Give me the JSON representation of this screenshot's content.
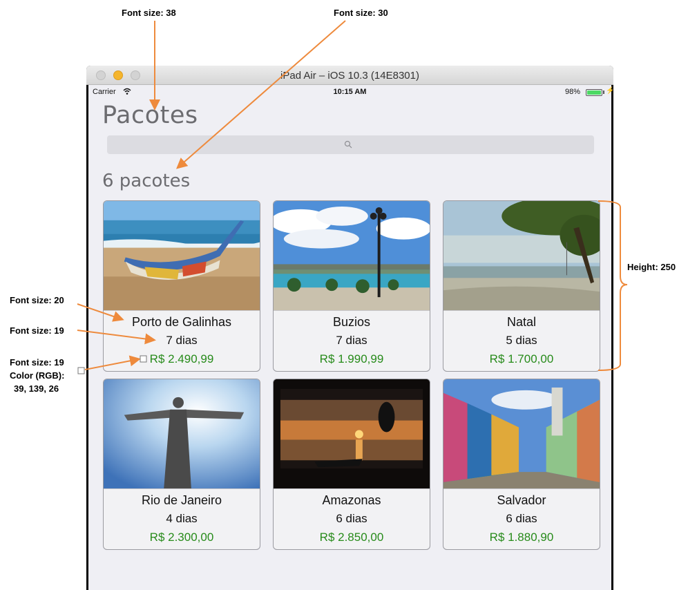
{
  "annotations": {
    "title_font": "Font size: 38",
    "subtitle_font": "Font size: 30",
    "name_font": "Font size: 20",
    "days_font": "Font size: 19",
    "price_font": "Font size: 19",
    "price_color_line1": "Color (RGB):",
    "price_color_line2": "39, 139, 26",
    "height": "Height: 250",
    "arrow_color": "#ee8a3c"
  },
  "window": {
    "title": "iPad Air – iOS 10.3 (14E8301)"
  },
  "status_bar": {
    "carrier": "Carrier",
    "time": "10:15 AM",
    "battery": "98%"
  },
  "header": {
    "title": "Pacotes",
    "search_placeholder": "",
    "count": "6 pacotes"
  },
  "colors": {
    "price": "#278b1a",
    "background": "#efeff4"
  },
  "packages": [
    {
      "name": "Porto de Galinhas",
      "days": "7 dias",
      "price": "R$ 2.490,99",
      "photo": "beach-boat-photo"
    },
    {
      "name": "Buzios",
      "days": "7 dias",
      "price": "R$ 1.990,99",
      "photo": "waterfront-lamppost-photo"
    },
    {
      "name": "Natal",
      "days": "5 dias",
      "price": "R$ 1.700,00",
      "photo": "beach-tree-photo"
    },
    {
      "name": "Rio de Janeiro",
      "days": "4 dias",
      "price": "R$ 2.300,00",
      "photo": "christ-redeemer-photo"
    },
    {
      "name": "Amazonas",
      "days": "6 dias",
      "price": "R$ 2.850,00",
      "photo": "river-sunset-photo"
    },
    {
      "name": "Salvador",
      "days": "6 dias",
      "price": "R$ 1.880,90",
      "photo": "colorful-street-photo"
    }
  ]
}
